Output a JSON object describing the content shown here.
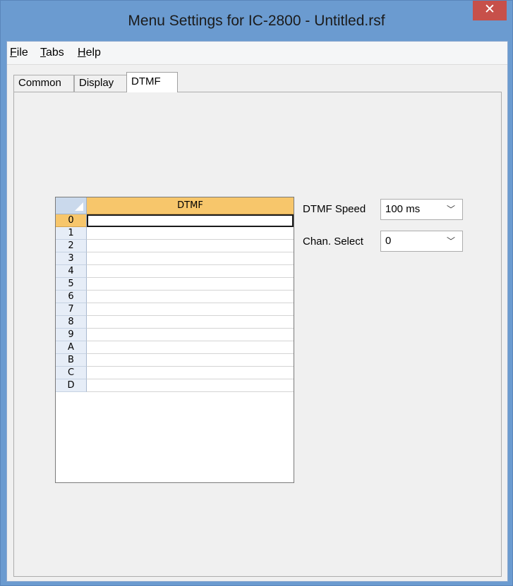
{
  "window": {
    "title": "Menu Settings for IC-2800 - Untitled.rsf",
    "close_glyph": "✕"
  },
  "menubar": {
    "items": [
      {
        "underline": "F",
        "rest": "ile"
      },
      {
        "underline": "T",
        "rest": "abs"
      },
      {
        "underline": "H",
        "rest": "elp"
      }
    ]
  },
  "tabs": [
    "Common",
    "Display",
    "DTMF"
  ],
  "active_tab": "DTMF",
  "grid": {
    "column_header": "DTMF",
    "rows": [
      {
        "key": "0",
        "value": ""
      },
      {
        "key": "1",
        "value": ""
      },
      {
        "key": "2",
        "value": ""
      },
      {
        "key": "3",
        "value": ""
      },
      {
        "key": "4",
        "value": ""
      },
      {
        "key": "5",
        "value": ""
      },
      {
        "key": "6",
        "value": ""
      },
      {
        "key": "7",
        "value": ""
      },
      {
        "key": "8",
        "value": ""
      },
      {
        "key": "9",
        "value": ""
      },
      {
        "key": "A",
        "value": ""
      },
      {
        "key": "B",
        "value": ""
      },
      {
        "key": "C",
        "value": ""
      },
      {
        "key": "D",
        "value": ""
      }
    ],
    "selected_row": "0"
  },
  "settings": {
    "dtmf_speed_label": "DTMF Speed",
    "dtmf_speed_value": "100 ms",
    "chan_select_label": "Chan. Select",
    "chan_select_value": "0",
    "dropdown_glyph": "﹀"
  },
  "colors": {
    "title_bar": "#6b9bd0",
    "close_button": "#c7504a",
    "grid_header": "#f7c66b",
    "row_header": "#e6edf7"
  }
}
